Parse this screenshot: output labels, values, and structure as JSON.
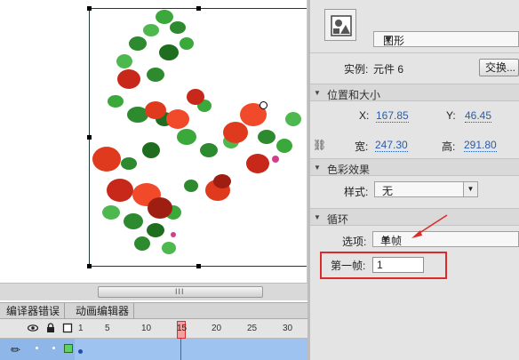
{
  "stage": {
    "scroll_grip": "III"
  },
  "timeline": {
    "tabs": [
      {
        "label": "编译器错误"
      },
      {
        "label": "动画编辑器"
      }
    ],
    "ruler": [
      "1",
      "5",
      "10",
      "15",
      "20",
      "25",
      "30"
    ],
    "current_frame": "15",
    "layer_color": "#5fd35f"
  },
  "properties": {
    "symbol_type": "图形",
    "instance_label": "实例:",
    "instance_name": "元件 6",
    "swap_button": "交换...",
    "position_section": "位置和大小",
    "x_label": "X:",
    "x_value": "167.85",
    "y_label": "Y:",
    "y_value": "46.45",
    "w_label": "宽:",
    "w_value": "247.30",
    "h_label": "高:",
    "h_value": "291.80",
    "color_section": "色彩效果",
    "style_label": "样式:",
    "style_value": "无",
    "loop_section": "循环",
    "option_label": "选项:",
    "option_value": "单帧",
    "first_frame_label": "第一帧:",
    "first_frame_value": "1"
  },
  "colors": {
    "highlight": "#e02a2a",
    "value_link": "#2a5caa",
    "flower_red": "#e03a1e",
    "leaf_green": "#2e8a2e"
  }
}
